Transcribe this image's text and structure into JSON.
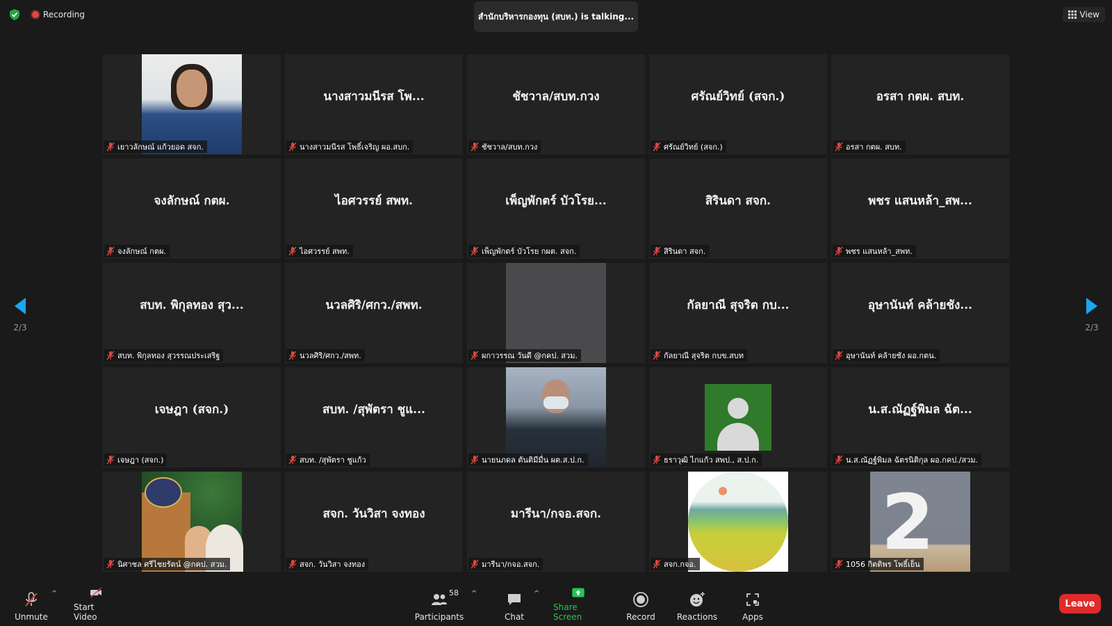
{
  "top": {
    "recording": "Recording",
    "talking": "สำนักบริหารกองทุน (สบท.) is talking...",
    "view": "View"
  },
  "pagination": {
    "left": "2/3",
    "right": "2/3"
  },
  "tiles": [
    {
      "big": "",
      "label": "เยาวลักษณ์ แก้วยอด สจก."
    },
    {
      "big": "นางสาวมนีรส โพ...",
      "label": "นางสาวมนีรส โพธิ์เจริญ ผอ.สบก."
    },
    {
      "big": "ชัชวาล/สบท.กวง",
      "label": "ชัชวาล/สบท.กวง"
    },
    {
      "big": "ศรัณย์วิทย์ (สจก.)",
      "label": "ศรัณย์วิทย์ (สจก.)"
    },
    {
      "big": "อรสา กตผ. สบท.",
      "label": "อรสา กตผ. สบท."
    },
    {
      "big": "จงลักษณ์ กตผ.",
      "label": "จงลักษณ์ กตผ."
    },
    {
      "big": "ไอศวรรย์ สพท.",
      "label": "ไอศวรรย์ สพท."
    },
    {
      "big": "เพ็ญพักตร์ บัวโรย...",
      "label": "เพ็ญพักตร์ บัวโรย กผต. สจก."
    },
    {
      "big": "สิรินดา สจก.",
      "label": "สิรินดา สจก."
    },
    {
      "big": "พชร แสนหล้า_สพ...",
      "label": "พชร แสนหล้า_สพท."
    },
    {
      "big": "สบท. พิกุลทอง สุว...",
      "label": "สบท. พิกุลทอง สุวรรณประเสริฐ"
    },
    {
      "big": "นวลศิริ/ศกว./สพท.",
      "label": "นวลศิริ/ศกว./สพท."
    },
    {
      "big": "",
      "label": "ผกาวรรณ วันดี @กคป. สวม."
    },
    {
      "big": "กัลยาณี สุจริต กบ...",
      "label": "กัลยาณี สุจริต กบข.สบท"
    },
    {
      "big": "อุษานันท์ คล้ายชัง...",
      "label": "อุษานันท์ คล้ายชัง ผอ.กตน."
    },
    {
      "big": "เจษฎา (สจก.)",
      "label": "เจษฎา (สจก.)"
    },
    {
      "big": "สบท. /สุพัตรา ชูแ...",
      "label": "สบท. /สุพัตรา ชูแก้ว"
    },
    {
      "big": "",
      "label": "นายนภดล ตันติมีมื่น ผต.ส.ป.ก."
    },
    {
      "big": "",
      "label": "ธราวุฒิ ไกแก้ว สพป., ส.ป.ก."
    },
    {
      "big": "น.ส.ณัฏฐ์พิมล ฉัต...",
      "label": "น.ส.ณัฏฐ์พิมล ฉัตรนิติกุล ผอ.กคป./สวม."
    },
    {
      "big": "",
      "label": "นิศาชล ศรีไชยรัตน์ @กคป. สวม."
    },
    {
      "big": "สจก. วันวิสา จงทอง",
      "label": "สจก. วันวิสา จงทอง"
    },
    {
      "big": "มารีนา/กจอ.สจก.",
      "label": "มารีนา/กจอ.สจก."
    },
    {
      "big": "",
      "label": "สจก.กจอ."
    },
    {
      "big": "",
      "label": "1056 กิตติพร โพธิ์เย็น"
    }
  ],
  "toolbar": {
    "unmute": "Unmute",
    "start_video": "Start Video",
    "participants": "Participants",
    "participants_count": "58",
    "chat": "Chat",
    "share_screen": "Share Screen",
    "record": "Record",
    "reactions": "Reactions",
    "apps": "Apps",
    "leave": "Leave"
  },
  "colors": {
    "background": "#1a1a1a",
    "tile": "#232323",
    "share_green": "#23c552",
    "leave_red": "#e02a2a",
    "nav_blue": "#1aa6f0",
    "mic_muted": "#e0483e"
  },
  "icons": [
    "shield-icon",
    "recording-icon",
    "view-grid-icon",
    "muted-mic-icon",
    "video-off-icon",
    "participants-icon",
    "chat-icon",
    "share-screen-icon",
    "record-icon",
    "reactions-icon",
    "apps-icon",
    "left-arrow-icon",
    "right-arrow-icon"
  ]
}
